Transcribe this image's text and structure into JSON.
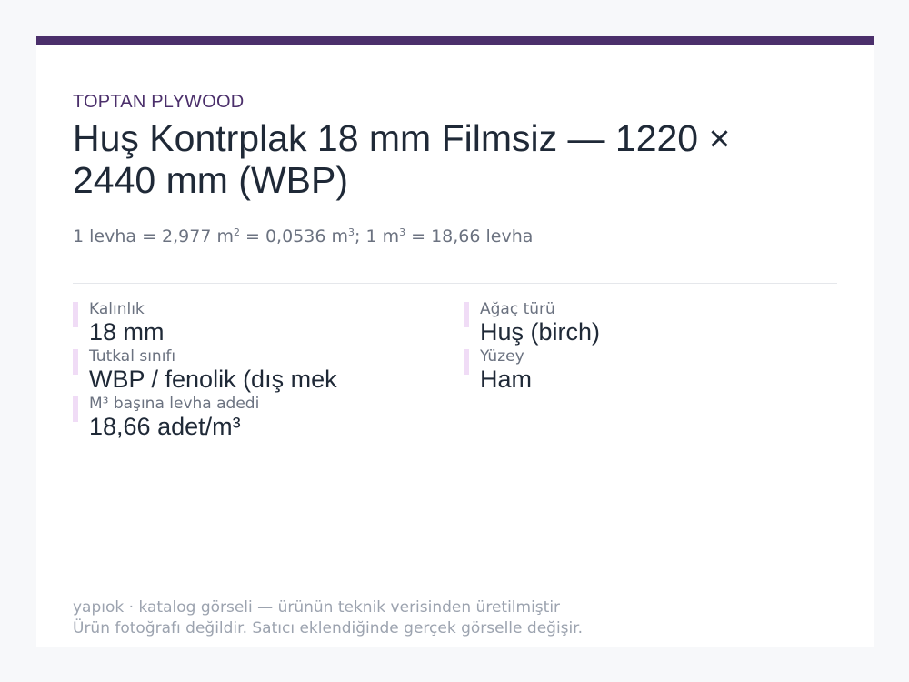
{
  "header": {
    "brand": "TOPTAN PLYWOOD",
    "title": "Huş Kontrplak 18 mm Filmsiz — 1220 × 2440 mm (WBP)",
    "subtitle": {
      "part1": "1 levha = 2,977 m",
      "sup1": "2",
      "part2": " = 0,0536 m",
      "sup2": "3",
      "part3": "; 1 m",
      "sup3": "3",
      "part4": " = 18,66 levha"
    }
  },
  "specs": [
    {
      "label": "Kalınlık",
      "value": "18 mm"
    },
    {
      "label": "Ağaç türü",
      "value": "Huş (birch)"
    },
    {
      "label": "Tutkal sınıfı",
      "value": "WBP / fenolik (dış mek"
    },
    {
      "label": "Yüzey",
      "value": "Ham"
    },
    {
      "label": "M³ başına levha adedi",
      "value": "18,66 adet/m³"
    }
  ],
  "footer": {
    "line1": "yapıok · katalog görseli — ürünün teknik verisinden üretilmiştir",
    "line2": "Ürün fotoğrafı değildir. Satıcı eklendiğinde gerçek görselle değişir."
  },
  "colors": {
    "accent": "#4b2f6b",
    "spec_marker": "#f0dcf6",
    "background": "#f7f8fa"
  }
}
